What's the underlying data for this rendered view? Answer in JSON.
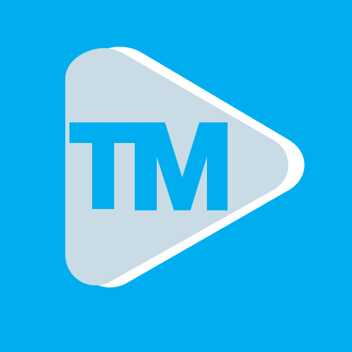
{
  "icon": {
    "name": "play-button-logo",
    "logo_text": "TM",
    "colors": {
      "background": "#00AEEF",
      "play_shadow": "#FFFFFF",
      "play_fill": "#C9DCE5",
      "text": "#00AEEF"
    }
  }
}
